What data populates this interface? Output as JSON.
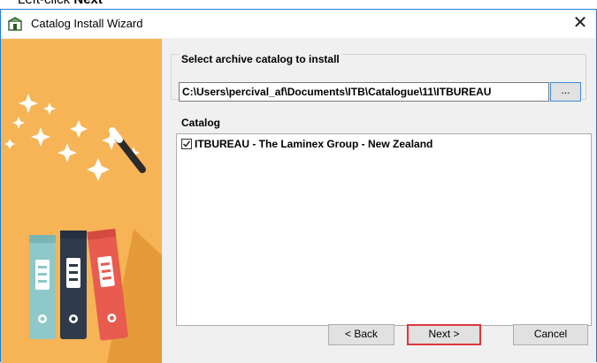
{
  "instruction": {
    "prefix": "Left-click ",
    "bold": "Next"
  },
  "window": {
    "title": "Catalog Install Wizard",
    "close_glyph": "✕"
  },
  "archive": {
    "label": "Select archive catalog to install",
    "path": "C:\\Users\\percival_af\\Documents\\ITB\\Catalogue\\11\\ITBUREAU",
    "browse_label": "..."
  },
  "catalog": {
    "label": "Catalog",
    "items": [
      {
        "label": "ITBUREAU - The Laminex Group - New Zealand",
        "checked": true
      }
    ]
  },
  "buttons": {
    "back": "< Back",
    "next": "Next >",
    "cancel": "Cancel"
  },
  "colors": {
    "art_background": "#f6b456",
    "highlight": "#e0363b",
    "window_border": "#1f7bd6"
  }
}
